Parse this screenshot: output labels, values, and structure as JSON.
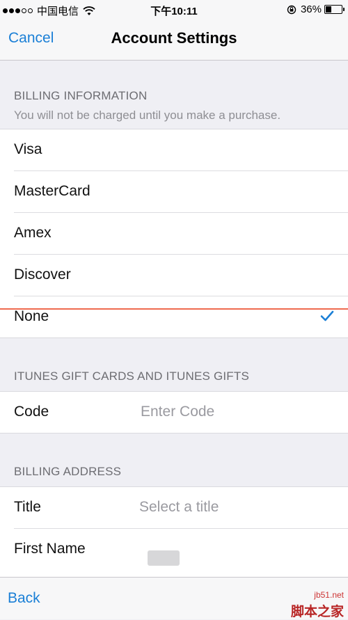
{
  "status_bar": {
    "carrier": "中国电信",
    "time": "下午10:11",
    "battery": "36%",
    "battery_level": 0.36,
    "signal_dots_filled": 3,
    "signal_dots_total": 5
  },
  "nav": {
    "cancel_label": "Cancel",
    "title": "Account Settings"
  },
  "billing": {
    "header": "BILLING INFORMATION",
    "subheader": "You will not be charged until you make a purchase.",
    "options": [
      {
        "label": "Visa"
      },
      {
        "label": "MasterCard"
      },
      {
        "label": "Amex"
      },
      {
        "label": "Discover"
      },
      {
        "label": "None",
        "selected": true
      }
    ]
  },
  "gift": {
    "header": "ITUNES GIFT CARDS AND ITUNES GIFTS",
    "code_label": "Code",
    "code_placeholder": "Enter Code"
  },
  "address": {
    "header": "BILLING ADDRESS",
    "title_label": "Title",
    "title_placeholder": "Select a title",
    "first_name_label": "First Name"
  },
  "toolbar": {
    "back_label": "Back"
  },
  "watermark": {
    "site": "jb51.net",
    "name": "脚本之家"
  },
  "colors": {
    "accent": "#1a7fd6",
    "background": "#efeff4",
    "divider_highlight": "#ef6a4f"
  },
  "icons": [
    "wifi-icon",
    "rotation-lock-icon",
    "battery-icon",
    "checkmark-icon"
  ]
}
